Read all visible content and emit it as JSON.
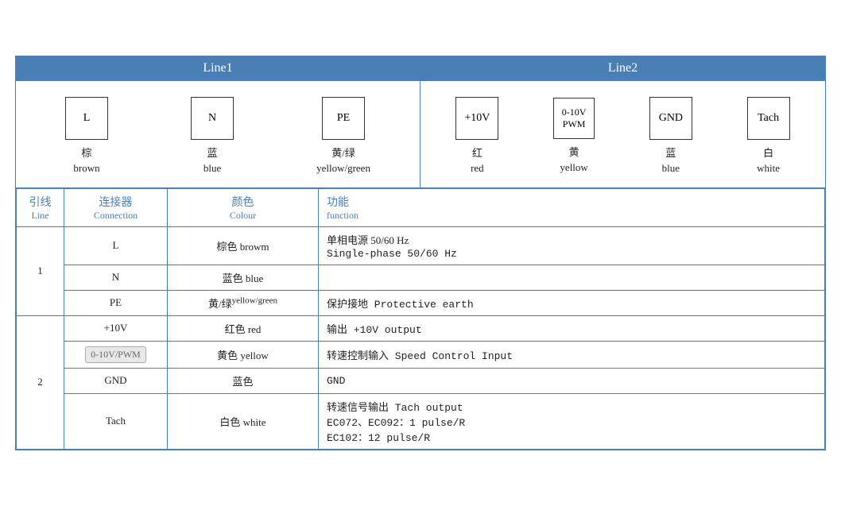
{
  "header": {
    "line1_label": "Line1",
    "line2_label": "Line2"
  },
  "diagram": {
    "line1_connectors": [
      {
        "id": "L",
        "zh": "棕",
        "en": "brown"
      },
      {
        "id": "N",
        "zh": "蓝",
        "en": "blue"
      },
      {
        "id": "PE",
        "zh": "黄/绿",
        "en": "yellow/green"
      }
    ],
    "line2_connectors": [
      {
        "id": "+10V",
        "zh": "红",
        "en": "red"
      },
      {
        "id": "0-10V\nPWM",
        "zh": "黄",
        "en": "yellow"
      },
      {
        "id": "GND",
        "zh": "蓝",
        "en": "blue"
      },
      {
        "id": "Tach",
        "zh": "白",
        "en": "white"
      }
    ]
  },
  "table": {
    "headers": {
      "line_zh": "引线",
      "line_en": "Line",
      "conn_zh": "连接器",
      "conn_en": "Connection",
      "color_zh": "颜色",
      "color_en": "Colour",
      "func_zh": "功能",
      "func_en": "function"
    },
    "rows": [
      {
        "line": "1",
        "rowspan": 3,
        "entries": [
          {
            "conn": "L",
            "color_zh": "棕色",
            "color_en": "browm",
            "func": "单相电源 50/60 Hz\nSingle-phase 50/60 Hz"
          },
          {
            "conn": "N",
            "color_zh": "蓝色",
            "color_en": "blue",
            "func": ""
          },
          {
            "conn": "PE",
            "color_zh": "黄/绿",
            "color_en_small": "yellow/green",
            "func": "保护接地 Protective earth"
          }
        ]
      },
      {
        "line": "2",
        "rowspan": 4,
        "entries": [
          {
            "conn": "+10V",
            "color_zh": "红色",
            "color_en": "red",
            "func": "输出 +10V output"
          },
          {
            "conn": "0-10V/PWM",
            "color_zh": "黄色",
            "color_en": "yellow",
            "func": "转速控制输入 Speed Control Input"
          },
          {
            "conn": "GND",
            "color_zh": "蓝色",
            "color_en": "",
            "func": "GND"
          },
          {
            "conn": "Tach",
            "color_zh": "白色",
            "color_en": "white",
            "func": "转速信号输出 Tach output\nEC072、EC092：1 pulse/R\nEC102：12 pulse/R"
          }
        ]
      }
    ]
  }
}
